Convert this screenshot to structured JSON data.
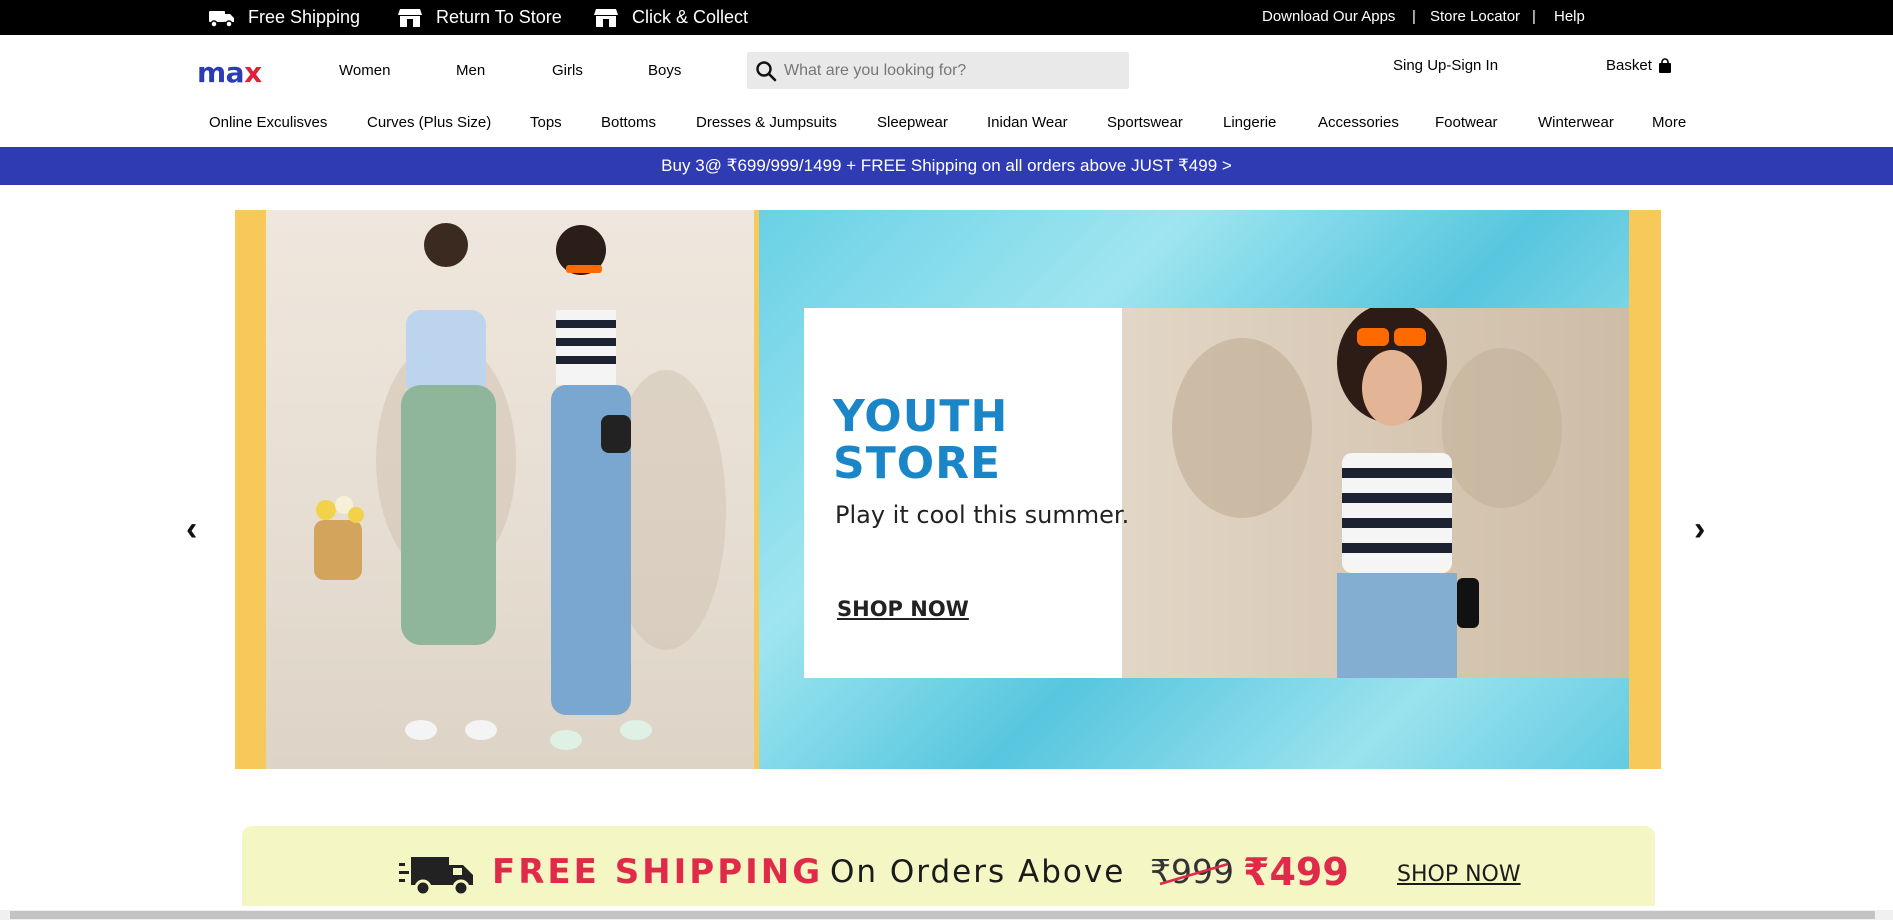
{
  "topbar": {
    "promos": [
      "Free Shipping",
      "Return To Store",
      "Click & Collect"
    ],
    "links": [
      "Download Our Apps",
      "|",
      "Store Locator",
      "|",
      "Help"
    ]
  },
  "header": {
    "logo_main": "ma",
    "logo_accent": "x",
    "main_nav": [
      "Women",
      "Men",
      "Girls",
      "Boys"
    ],
    "search_placeholder": "What are you looking for?",
    "signin": "Sing Up-Sign In",
    "basket": "Basket"
  },
  "categories": [
    "Online Exculisves",
    "Curves (Plus Size)",
    "Tops",
    "Bottoms",
    "Dresses & Jumpsuits",
    "Sleepwear",
    "Inidan Wear",
    "Sportswear",
    "Lingerie",
    "Accessories",
    "Footwear",
    "Winterwear",
    "More"
  ],
  "offer_bar": "Buy 3@ ₹699/999/1499 + FREE Shipping on all orders above JUST ₹499 >",
  "hero": {
    "title_line1": "YOUTH",
    "title_line2": "STORE",
    "tagline": "Play it cool  this summer.",
    "cta": "SHOP NOW",
    "prev": "‹",
    "next": "›"
  },
  "shipping_banner": {
    "headline": "FREE SHIPPING",
    "text": "On Orders Above",
    "old_price": "₹999",
    "new_price": "₹499",
    "cta": "SHOP NOW"
  },
  "colors": {
    "brand_blue": "#2e3bb3",
    "brand_red": "#e0213a",
    "hero_accent": "#f7c85a",
    "youth_blue": "#1a86c7"
  }
}
